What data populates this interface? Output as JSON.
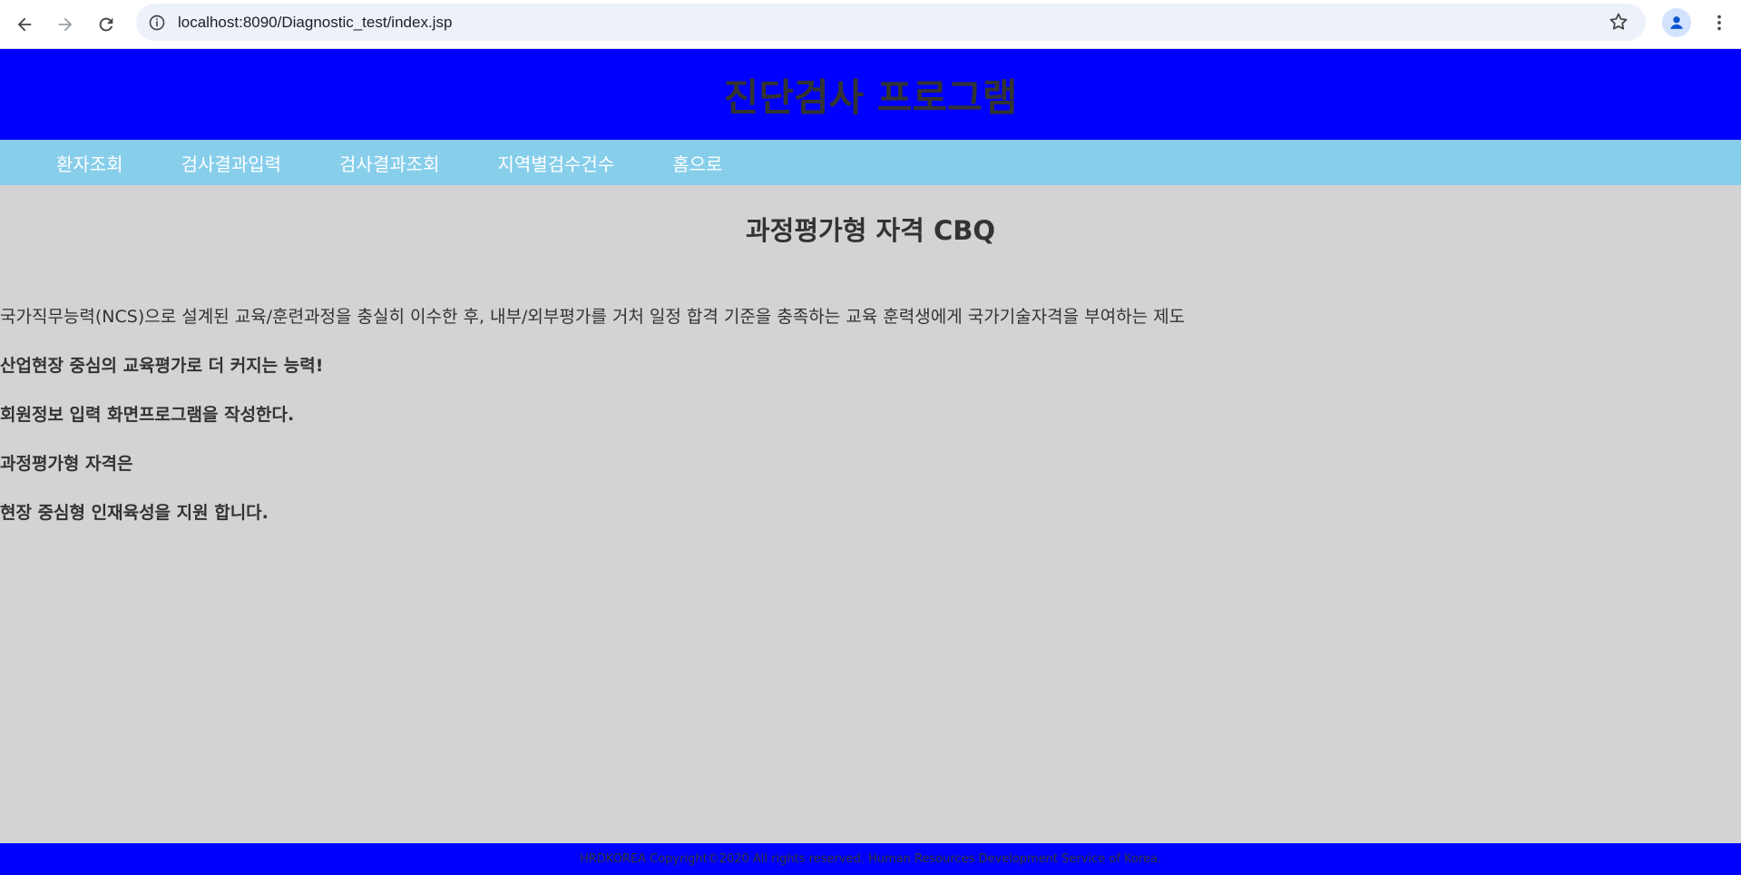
{
  "browser": {
    "url": "localhost:8090/Diagnostic_test/index.jsp"
  },
  "header": {
    "title": "진단검사 프로그램"
  },
  "menu": {
    "items": [
      "환자조회",
      "검사결과입력",
      "검사결과조회",
      "지역별검수건수",
      "홈으로"
    ]
  },
  "main": {
    "heading": "과정평가형 자격 CBQ",
    "intro": "국가직무능력(NCS)으로 설계된 교육/훈련과정을 충실히 이수한 후, 내부/외부평가를 거처 일정 합격 기준을 충족하는 교육 훈력생에게 국가기술자격을 부여하는 제도",
    "lines": [
      "산업현장 중심의 교육평가로 더 커지는 능력!",
      "회원정보 입력 화면프로그램을 작성한다.",
      "과정평가형 자격은",
      "현장 중심형 인재육성을 지원 합니다."
    ]
  },
  "footer": {
    "text": "HRDKOREA Copyright©2020 All rights reserved. Human Resources Development Service of Korea."
  },
  "colors": {
    "header_bg": "#0000ff",
    "menu_bg": "#87ceeb",
    "body_bg": "#d3d3d3",
    "footer_bg": "#0000ff"
  }
}
